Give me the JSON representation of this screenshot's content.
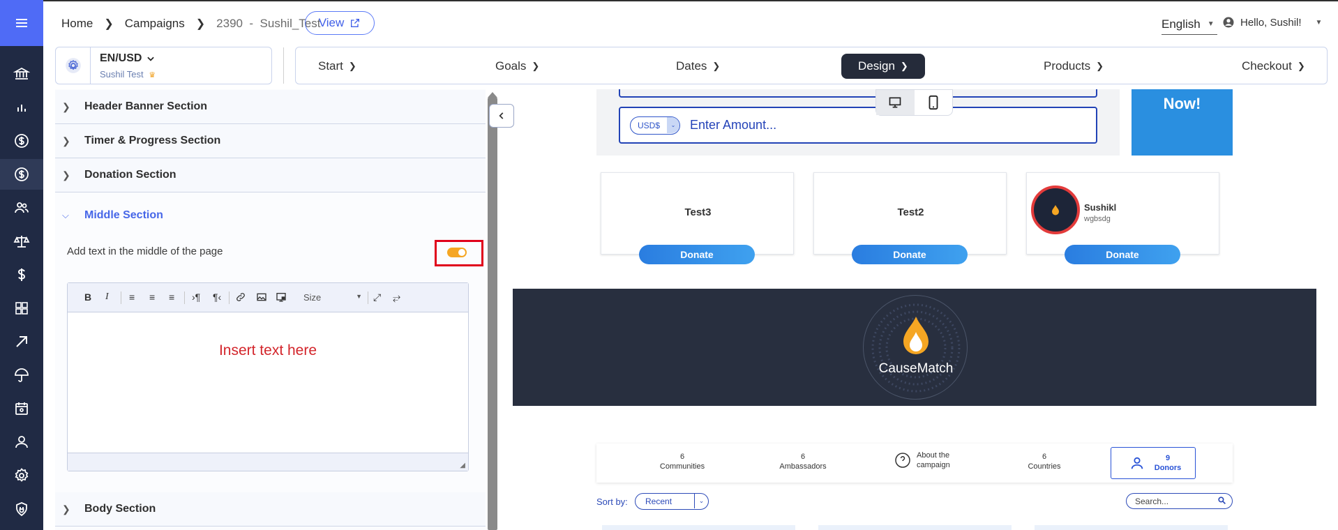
{
  "breadcrumb": {
    "home": "Home",
    "campaigns": "Campaigns",
    "current": "2390  -  Sushil_Test"
  },
  "view_button": "View",
  "language": "English",
  "greeting": "Hello, Sushil!",
  "org": {
    "currency": "EN/USD",
    "name": "Sushil Test"
  },
  "steps": [
    "Start",
    "Goals",
    "Dates",
    "Design",
    "Products",
    "Checkout"
  ],
  "active_step": "Design",
  "sections": {
    "header": "Header Banner Section",
    "timer": "Timer & Progress Section",
    "donation": "Donation Section",
    "middle": "Middle Section",
    "body": "Body Section"
  },
  "middle": {
    "toggle_label": "Add text in the middle of the page",
    "toggle_on": true,
    "editor_text": "Insert text here",
    "size_label": "Size"
  },
  "preview": {
    "currency_chip": "USD$",
    "amount_placeholder": "Enter Amount...",
    "cta": "Now!",
    "cards": [
      {
        "name": "Test3",
        "button": "Donate"
      },
      {
        "name": "Test2",
        "button": "Donate"
      },
      {
        "name": "Sushikl",
        "sub": "wgbsdg",
        "button": "Donate"
      }
    ],
    "logo_text": "CauseMatch",
    "stats": [
      {
        "count": "6",
        "label": "Communities"
      },
      {
        "count": "6",
        "label": "Ambassadors"
      },
      {
        "count": "",
        "label": "About the\ncampaign"
      },
      {
        "count": "6",
        "label": "Countries"
      },
      {
        "count": "9",
        "label": "Donors"
      }
    ],
    "sort_label": "Sort by:",
    "sort_value": "Recent",
    "search_placeholder": "Search..."
  },
  "colors": {
    "rail": "#202a44",
    "accent": "#4f6bf6",
    "toggle": "#f5a623",
    "highlight_box": "#e0001b",
    "banner": "#282f3f"
  }
}
